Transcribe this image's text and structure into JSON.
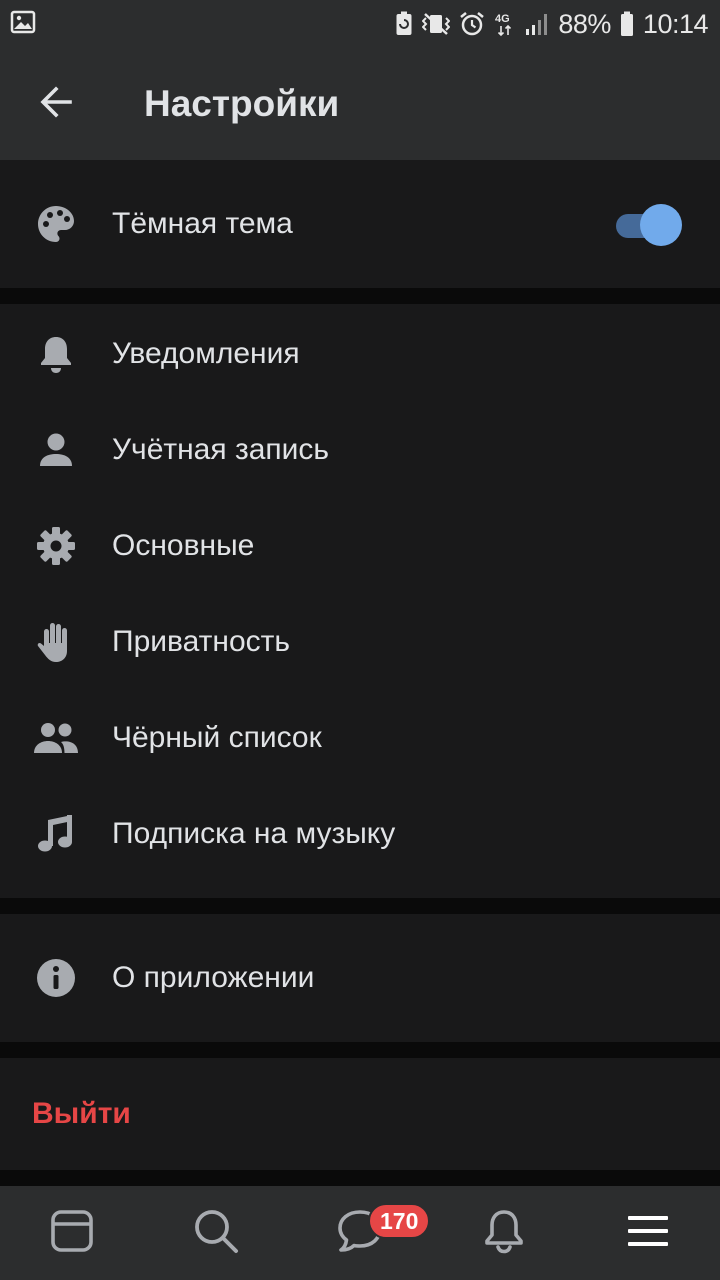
{
  "status_bar": {
    "battery_percent": "88%",
    "network": "4G",
    "time": "10:14",
    "icons": [
      "image-notification-icon",
      "battery-saver-icon",
      "vibrate-icon",
      "alarm-icon",
      "network-4g-icon",
      "signal-icon",
      "battery-icon"
    ]
  },
  "header": {
    "title": "Настройки",
    "back_icon": "arrow-left-icon"
  },
  "settings": {
    "dark_theme": {
      "label": "Тёмная тема",
      "icon": "palette-icon",
      "enabled": true
    },
    "items": [
      {
        "label": "Уведомления",
        "icon": "bell-icon"
      },
      {
        "label": "Учётная запись",
        "icon": "user-icon"
      },
      {
        "label": "Основные",
        "icon": "gear-icon"
      },
      {
        "label": "Приватность",
        "icon": "hand-icon"
      },
      {
        "label": "Чёрный список",
        "icon": "users-icon"
      },
      {
        "label": "Подписка на музыку",
        "icon": "music-note-icon"
      }
    ],
    "about": {
      "label": "О приложении",
      "icon": "info-icon"
    },
    "logout": {
      "label": "Выйти"
    }
  },
  "tab_bar": {
    "tabs": [
      {
        "name": "news",
        "icon": "newsfeed-icon"
      },
      {
        "name": "search",
        "icon": "search-icon"
      },
      {
        "name": "messages",
        "icon": "chat-bubble-icon"
      },
      {
        "name": "notifications",
        "icon": "bell-icon"
      },
      {
        "name": "menu",
        "icon": "menu-icon"
      }
    ],
    "messages_badge": "170"
  },
  "colors": {
    "background": "#0a0a0a",
    "surface": "#19191a",
    "header": "#2c2d2e",
    "text": "#e1e3e6",
    "icon": "#a8abb0",
    "accent": "#71aaeb",
    "destructive": "#e64646"
  }
}
